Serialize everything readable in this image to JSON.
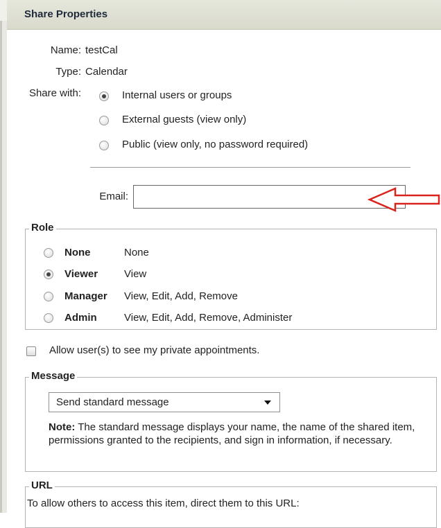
{
  "header": {
    "title": "Share Properties"
  },
  "properties": {
    "name_label": "Name:",
    "name_value": "testCal",
    "type_label": "Type:",
    "type_value": "Calendar",
    "share_with_label": "Share with:"
  },
  "share_options": [
    {
      "label": "Internal users or groups",
      "checked": true
    },
    {
      "label": "External guests (view only)",
      "checked": false
    },
    {
      "label": "Public (view only, no password required)",
      "checked": false
    }
  ],
  "email": {
    "label": "Email:",
    "value": "",
    "placeholder": ""
  },
  "annotation": {
    "arrow_color": "#d9231d"
  },
  "role": {
    "legend": "Role",
    "options": [
      {
        "name": "None",
        "desc": "None",
        "checked": false
      },
      {
        "name": "Viewer",
        "desc": "View",
        "checked": true
      },
      {
        "name": "Manager",
        "desc": "View, Edit, Add, Remove",
        "checked": false
      },
      {
        "name": "Admin",
        "desc": "View, Edit, Add, Remove, Administer",
        "checked": false
      }
    ]
  },
  "private_appointments": {
    "label": "Allow user(s) to see my private appointments.",
    "checked": false
  },
  "message": {
    "legend": "Message",
    "selected": "Send standard message",
    "note_label": "Note:",
    "note_text": " The standard message displays your name, the name of the shared item, permissions granted to the recipients, and sign in information, if necessary."
  },
  "url": {
    "legend": "URL",
    "text": "To allow others to access this item, direct them to this URL:"
  }
}
